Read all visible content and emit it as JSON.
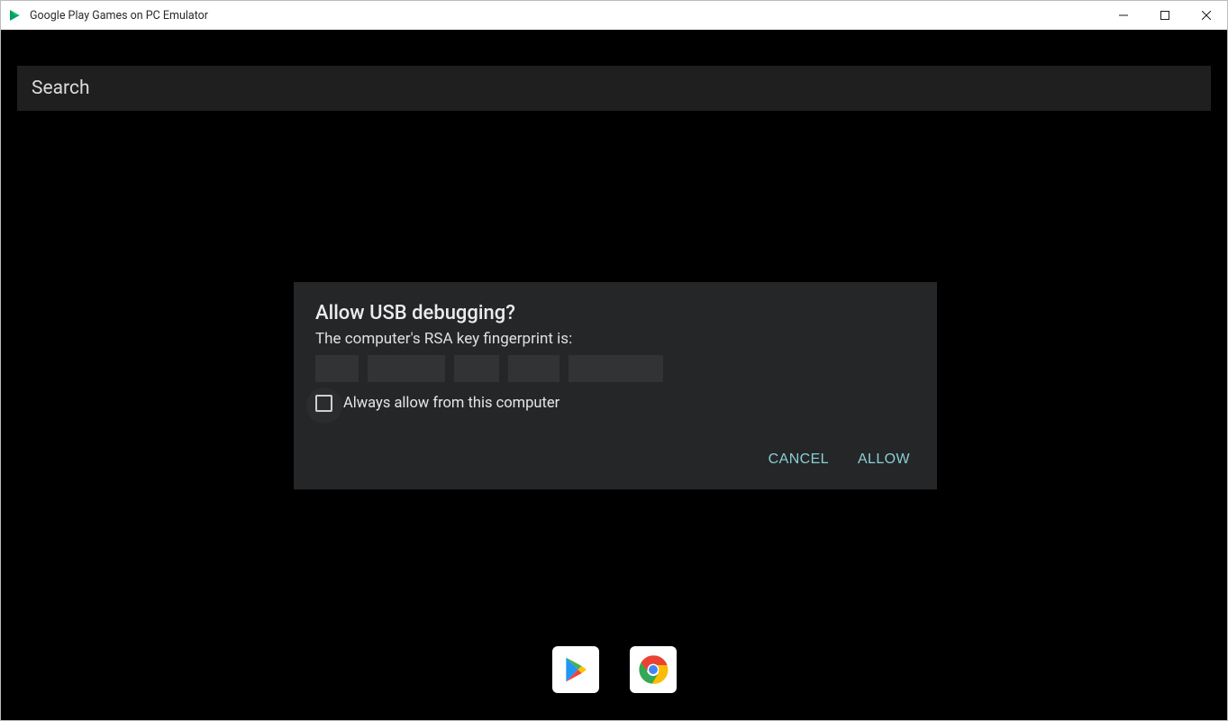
{
  "window": {
    "title": "Google Play Games on PC Emulator"
  },
  "search": {
    "placeholder": "Search"
  },
  "dialog": {
    "title": "Allow USB debugging?",
    "subtitle": "The computer's RSA key fingerprint is:",
    "checkbox_label": "Always allow from this computer",
    "cancel_label": "CANCEL",
    "allow_label": "ALLOW"
  },
  "dock": {
    "play_store": "Play Store",
    "chrome": "Chrome"
  }
}
